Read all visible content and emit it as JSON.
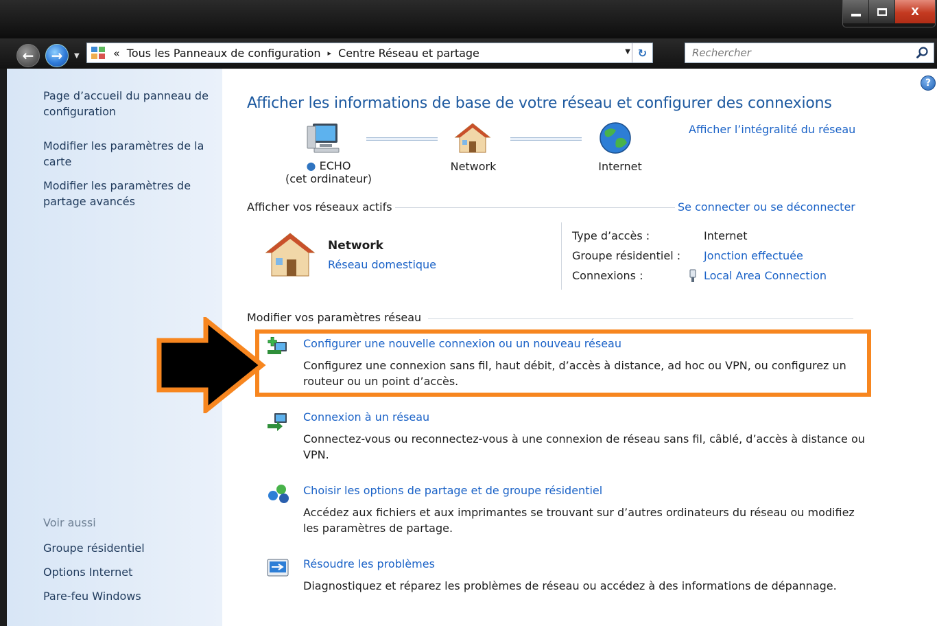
{
  "window": {
    "controls": {
      "minimize": "",
      "maximize": "",
      "close": "X"
    }
  },
  "address": {
    "overflow": "«",
    "crumbs": [
      "Tous les Panneaux de configuration",
      "Centre Réseau et partage"
    ],
    "separator": "▸"
  },
  "search": {
    "placeholder": "Rechercher"
  },
  "sidebar": {
    "links": [
      "Page d’accueil du panneau de configuration",
      "Modifier les paramètres de la carte",
      "Modifier les paramètres de partage avancés"
    ],
    "see_also_title": "Voir aussi",
    "see_also": [
      "Groupe résidentiel",
      "Options Internet",
      "Pare-feu Windows"
    ]
  },
  "main": {
    "title": "Afficher les informations de base de votre réseau et configurer des connexions",
    "view_full_map": "Afficher l’intégralité du réseau",
    "map": {
      "computer_name": "ECHO",
      "computer_sub": "(cet ordinateur)",
      "network": "Network",
      "internet": "Internet"
    },
    "active_networks_title": "Afficher vos réseaux actifs",
    "connect_disconnect": "Se connecter ou se déconnecter",
    "active_network": {
      "name": "Network",
      "type": "Réseau domestique",
      "props": [
        {
          "label": "Type d’accès :",
          "value": "Internet"
        },
        {
          "label": "Groupe résidentiel :",
          "value": "Jonction effectuée"
        },
        {
          "label": "Connexions :",
          "value": "Local Area Connection"
        }
      ]
    },
    "change_settings_title": "Modifier vos paramètres réseau",
    "tasks": [
      {
        "link": "Configurer une nouvelle connexion ou un nouveau réseau",
        "desc": "Configurez une connexion sans fil, haut débit, d’accès à distance, ad hoc ou VPN, ou configurez un routeur ou un point d’accès.",
        "icon": "new-connection-icon"
      },
      {
        "link": "Connexion à un réseau",
        "desc": "Connectez-vous ou reconnectez-vous à une connexion de réseau sans fil, câblé, d’accès à distance ou VPN.",
        "icon": "connect-network-icon"
      },
      {
        "link": "Choisir les options de partage et de groupe résidentiel",
        "desc": "Accédez aux fichiers et aux imprimantes se trouvant sur d’autres ordinateurs du réseau ou modifiez les paramètres de partage.",
        "icon": "homegroup-icon"
      },
      {
        "link": "Résoudre les problèmes",
        "desc": "Diagnostiquez et réparez les problèmes de réseau ou accédez à des informations de dépannage.",
        "icon": "troubleshoot-icon"
      }
    ]
  },
  "annotation": {
    "highlight_color": "#f7861f",
    "arrow_color": "#000000"
  },
  "colors": {
    "link": "#1a62c7",
    "title": "#1e5aa0",
    "sidebar_text": "#1e395b"
  }
}
